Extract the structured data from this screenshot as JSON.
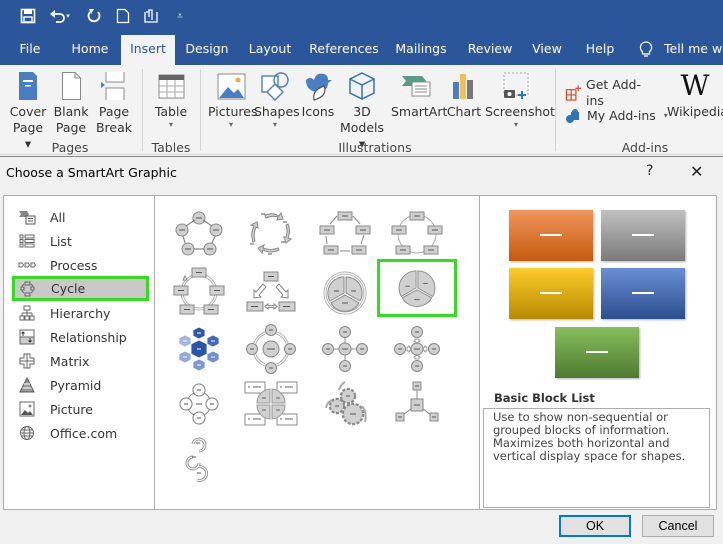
{
  "quick_access": {
    "icons": [
      "save-icon",
      "undo-icon",
      "redo-icon",
      "new-document-icon",
      "touch-mode-icon",
      "customize-qat-icon"
    ]
  },
  "tabs": [
    {
      "label": "File",
      "active": false
    },
    {
      "label": "Home",
      "active": false
    },
    {
      "label": "Insert",
      "active": true
    },
    {
      "label": "Design",
      "active": false
    },
    {
      "label": "Layout",
      "active": false
    },
    {
      "label": "References",
      "active": false
    },
    {
      "label": "Mailings",
      "active": false
    },
    {
      "label": "Review",
      "active": false
    },
    {
      "label": "View",
      "active": false
    },
    {
      "label": "Help",
      "active": false
    }
  ],
  "tell_me": "Tell me wh",
  "ribbon": {
    "groups": [
      {
        "label": "Pages",
        "buttons": [
          {
            "line1": "Cover",
            "line2": "Page ▾"
          },
          {
            "line1": "Blank",
            "line2": "Page"
          },
          {
            "line1": "Page",
            "line2": "Break"
          }
        ]
      },
      {
        "label": "Tables",
        "buttons": [
          {
            "line1": "Table",
            "line2": "▾"
          }
        ]
      },
      {
        "label": "Illustrations",
        "buttons": [
          {
            "line1": "Pictures",
            "line2": "▾"
          },
          {
            "line1": "Shapes",
            "line2": "▾"
          },
          {
            "line1": "Icons",
            "line2": ""
          },
          {
            "line1": "3D",
            "line2": "Models ▾"
          },
          {
            "line1": "SmartArt",
            "line2": ""
          },
          {
            "line1": "Chart",
            "line2": ""
          },
          {
            "line1": "Screenshot",
            "line2": "▾"
          }
        ]
      },
      {
        "label": "Add-ins",
        "buttons": [
          {
            "line1": "Get Add-ins"
          },
          {
            "line1": "My Add-ins"
          },
          {
            "line1": "Wikipedia"
          }
        ]
      }
    ]
  },
  "dialog": {
    "title": "Choose a SmartArt Graphic",
    "help": "?",
    "close": "✕",
    "categories": [
      {
        "label": "All",
        "icon": "all-icon",
        "selected": false
      },
      {
        "label": "List",
        "icon": "list-icon",
        "selected": false
      },
      {
        "label": "Process",
        "icon": "process-icon",
        "selected": false
      },
      {
        "label": "Cycle",
        "icon": "cycle-icon",
        "selected": true
      },
      {
        "label": "Hierarchy",
        "icon": "hierarchy-icon",
        "selected": false
      },
      {
        "label": "Relationship",
        "icon": "relationship-icon",
        "selected": false
      },
      {
        "label": "Matrix",
        "icon": "matrix-icon",
        "selected": false
      },
      {
        "label": "Pyramid",
        "icon": "pyramid-icon",
        "selected": false
      },
      {
        "label": "Picture",
        "icon": "picture-icon",
        "selected": false
      },
      {
        "label": "Office.com",
        "icon": "globe-icon",
        "selected": false
      }
    ],
    "gallery": [
      {
        "name": "basic-cycle"
      },
      {
        "name": "text-cycle"
      },
      {
        "name": "cycle"
      },
      {
        "name": "block-cycle"
      },
      {
        "name": "nondirectional-cycle"
      },
      {
        "name": "continuous-cycle"
      },
      {
        "name": "segmented-cycle"
      },
      {
        "name": "basic-pie",
        "selected": true
      },
      {
        "name": "hexagon-radial"
      },
      {
        "name": "radial-cycle"
      },
      {
        "name": "basic-radial"
      },
      {
        "name": "diverging-radial"
      },
      {
        "name": "radial-venn"
      },
      {
        "name": "cycle-matrix"
      },
      {
        "name": "gear"
      },
      {
        "name": "radial-cluster"
      },
      {
        "name": "circle-arrow-process"
      }
    ],
    "preview": {
      "title": "Basic Block List",
      "description": "Use to show non-sequential or grouped blocks of information. Maximizes both horizontal and vertical display space for shapes.",
      "blocks": [
        {
          "color_top": "#f0955a",
          "color_bottom": "#c55a11"
        },
        {
          "color_top": "#c0c0c0",
          "color_bottom": "#7a7a7a"
        },
        {
          "color_top": "#fdcb2b",
          "color_bottom": "#b88a00"
        },
        {
          "color_top": "#6a8ed4",
          "color_bottom": "#2c4f8e"
        },
        {
          "color_top": "#86bf5e",
          "color_bottom": "#4f7a30"
        }
      ]
    },
    "ok_label": "OK",
    "cancel_label": "Cancel"
  },
  "colors": {
    "brand_blue": "#2b579a",
    "selection_green": "#33dd22",
    "default_button_border": "#0078d7"
  }
}
